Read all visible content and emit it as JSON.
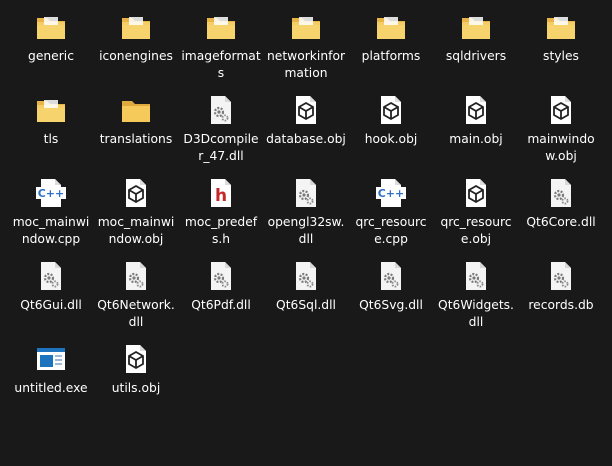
{
  "files": [
    {
      "name": "generic",
      "icon": "folder-icon"
    },
    {
      "name": "iconengines",
      "icon": "folder-icon"
    },
    {
      "name": "imageformats",
      "icon": "folder-icon"
    },
    {
      "name": "networkinformation",
      "icon": "folder-icon"
    },
    {
      "name": "platforms",
      "icon": "folder-icon"
    },
    {
      "name": "sqldrivers",
      "icon": "folder-icon"
    },
    {
      "name": "styles",
      "icon": "folder-icon"
    },
    {
      "name": "tls",
      "icon": "folder-icon"
    },
    {
      "name": "translations",
      "icon": "empty-folder-icon"
    },
    {
      "name": "D3Dcompiler_47.dll",
      "icon": "dll-file-icon"
    },
    {
      "name": "database.obj",
      "icon": "obj-file-icon"
    },
    {
      "name": "hook.obj",
      "icon": "obj-file-icon"
    },
    {
      "name": "main.obj",
      "icon": "obj-file-icon"
    },
    {
      "name": "mainwindow.obj",
      "icon": "obj-file-icon"
    },
    {
      "name": "moc_mainwindow.cpp",
      "icon": "cpp-file-icon"
    },
    {
      "name": "moc_mainwindow.obj",
      "icon": "obj-file-icon"
    },
    {
      "name": "moc_predefs.h",
      "icon": "h-file-icon"
    },
    {
      "name": "opengl32sw.dll",
      "icon": "dll-file-icon"
    },
    {
      "name": "qrc_resource.cpp",
      "icon": "cpp-file-icon"
    },
    {
      "name": "qrc_resource.obj",
      "icon": "obj-file-icon"
    },
    {
      "name": "Qt6Core.dll",
      "icon": "dll-file-icon"
    },
    {
      "name": "Qt6Gui.dll",
      "icon": "dll-file-icon"
    },
    {
      "name": "Qt6Network.dll",
      "icon": "dll-file-icon"
    },
    {
      "name": "Qt6Pdf.dll",
      "icon": "dll-file-icon"
    },
    {
      "name": "Qt6Sql.dll",
      "icon": "dll-file-icon"
    },
    {
      "name": "Qt6Svg.dll",
      "icon": "dll-file-icon"
    },
    {
      "name": "Qt6Widgets.dll",
      "icon": "dll-file-icon"
    },
    {
      "name": "records.db",
      "icon": "db-file-icon"
    },
    {
      "name": "untitled.exe",
      "icon": "exe-file-icon"
    },
    {
      "name": "utils.obj",
      "icon": "obj-file-icon"
    }
  ],
  "colors": {
    "background": "#191919",
    "text": "#ffffff",
    "folder": "#f2c55c",
    "cpp": "#2f6fc7",
    "header": "#c62828",
    "exe": "#1e73be"
  }
}
